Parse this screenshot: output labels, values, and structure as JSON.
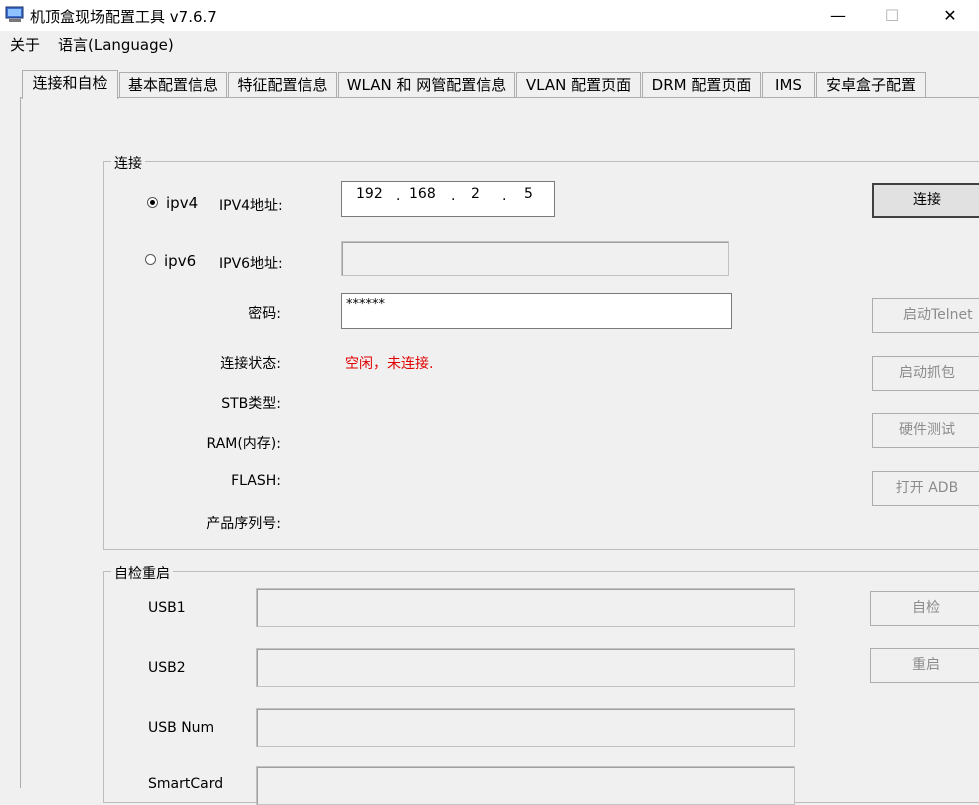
{
  "window": {
    "title": "机顶盒现场配置工具 v7.6.7",
    "controls": {
      "minimize": "—",
      "maximize": "☐",
      "close": "✕"
    }
  },
  "menu": {
    "about": "关于",
    "language": "语言(Language)"
  },
  "tabs": [
    {
      "label": "连接和自检"
    },
    {
      "label": "基本配置信息"
    },
    {
      "label": "特征配置信息"
    },
    {
      "label": "WLAN 和 网管配置信息"
    },
    {
      "label": "VLAN 配置页面"
    },
    {
      "label": "DRM 配置页面"
    },
    {
      "label": "IMS"
    },
    {
      "label": "安卓盒子配置"
    }
  ],
  "connection": {
    "group_label": "连接",
    "ipv4_option": "ipv4",
    "ipv4_label": "IPV4地址:",
    "ipv4_octets": [
      "192",
      "168",
      "2",
      "5"
    ],
    "ipv4_dot": ".",
    "ipv6_option": "ipv6",
    "ipv6_label": "IPV6地址:",
    "ipv6_value": "",
    "password_label": "密码:",
    "password_value": "******",
    "status_label": "连接状态:",
    "status_value": "空闲，未连接.",
    "stb_type_label": "STB类型:",
    "ram_label": "RAM(内存):",
    "flash_label": "FLASH:",
    "serial_label": "产品序列号:",
    "buttons": {
      "connect": "连接",
      "telnet": "启动Telnet",
      "capture": "启动抓包",
      "hwtest": "硬件测试",
      "adb": "打开 ADB"
    }
  },
  "selftest": {
    "group_label": "自检重启",
    "usb1_label": "USB1",
    "usb2_label": "USB2",
    "usbnum_label": "USB Num",
    "smartcard_label": "SmartCard",
    "buttons": {
      "selfcheck": "自检",
      "reboot": "重启"
    }
  },
  "colors": {
    "status_text": "#e00000",
    "background": "#f0f0f0"
  }
}
